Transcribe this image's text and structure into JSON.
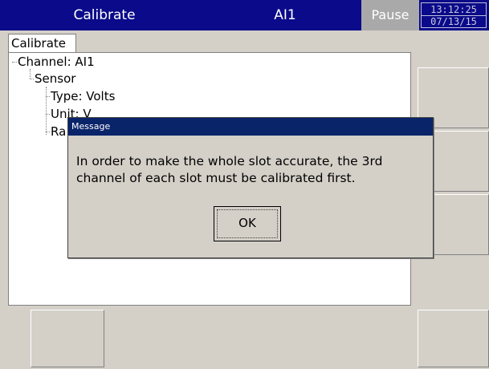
{
  "topbar": {
    "title": "Calibrate",
    "channel": "AI1",
    "status": "Pause",
    "time": "13:12:25",
    "date": "07/13/15"
  },
  "tab": {
    "label": "Calibrate"
  },
  "tree": {
    "channel": "Channel: AI1",
    "sensor": "Sensor",
    "type": "Type: Volts",
    "unit": "Unit: V",
    "range_partial": "Ra"
  },
  "dialog": {
    "title": "Message",
    "message_line1": "In order to make the whole slot accurate, the 3rd",
    "message_line2": "channel of each slot must be calibrated first.",
    "ok_label": "OK"
  },
  "colors": {
    "topbar": "#0a0a8a",
    "dialog_title": "#0a246a",
    "status_bg": "#a9a9a9",
    "face": "#d4d0c8"
  }
}
